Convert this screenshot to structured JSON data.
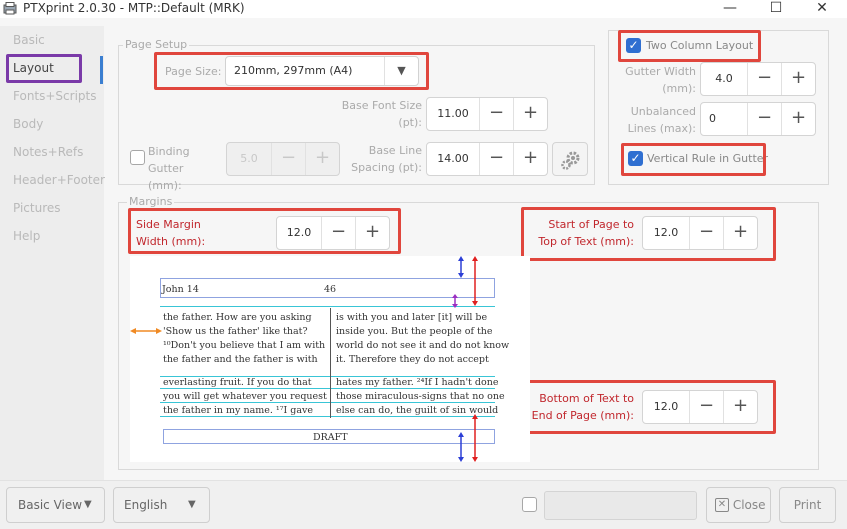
{
  "window": {
    "title": "PTXprint 2.0.30  -  MTP::Default  (MRK)"
  },
  "sidebar": {
    "items": [
      {
        "label": "Basic"
      },
      {
        "label": "Layout"
      },
      {
        "label": "Fonts+Scripts"
      },
      {
        "label": "Body"
      },
      {
        "label": "Notes+Refs"
      },
      {
        "label": "Header+Footer"
      },
      {
        "label": "Pictures"
      },
      {
        "label": "Help"
      }
    ]
  },
  "page_setup": {
    "section_title": "Page Setup",
    "page_size_label": "Page Size:",
    "page_size_value": "210mm, 297mm (A4)",
    "base_font_label": "Base Font Size (pt):",
    "base_font_value": "11.00",
    "binding_label": "Binding Gutter (mm):",
    "binding_value": "5.0",
    "line_spacing_label": "Base Line Spacing (pt):",
    "line_spacing_value": "14.00"
  },
  "columns": {
    "two_column_label": "Two Column Layout",
    "gutter_label": "Gutter Width (mm):",
    "gutter_value": "4.0",
    "unbalanced_label": "Unbalanced Lines (max):",
    "unbalanced_value": "0",
    "vertical_rule_label": "Vertical Rule in Gutter"
  },
  "margins": {
    "section_title": "Margins",
    "side_label": "Side Margin Width (mm):",
    "side_value": "12.0",
    "top_label": "Start of Page to Top of Text (mm):",
    "top_value": "12.0",
    "bottom_label": "Bottom of Text to End of Page (mm):",
    "bottom_value": "12.0"
  },
  "preview": {
    "header_left": "John 14",
    "header_page": "46",
    "left_lines": [
      "the father. How are you asking",
      "'Show us the father' like that?",
      "¹⁰Don't you believe that I am with",
      "the father and the father is with",
      "everlasting fruit. If you do that",
      "you will get whatever you request",
      "the father in my name. ¹⁷I gave"
    ],
    "right_lines": [
      "is with you and later [it] will be",
      "inside you. But the people of the",
      "world do not see it and do not know",
      "it. Therefore they do not accept",
      "hates my father. ²⁴If I hadn't done",
      "those miraculous-signs that no one",
      "else can do, the guilt of sin would"
    ],
    "footer": "DRAFT"
  },
  "bottom_bar": {
    "view_label": "Basic View",
    "language_label": "English",
    "close_label": "Close",
    "print_label": "Print"
  },
  "colors": {
    "accent": "#2f6fd1",
    "annotation_red": "#e0463d",
    "annotation_purple": "#7a3aa8",
    "guide_cyan": "#39c5d6"
  }
}
